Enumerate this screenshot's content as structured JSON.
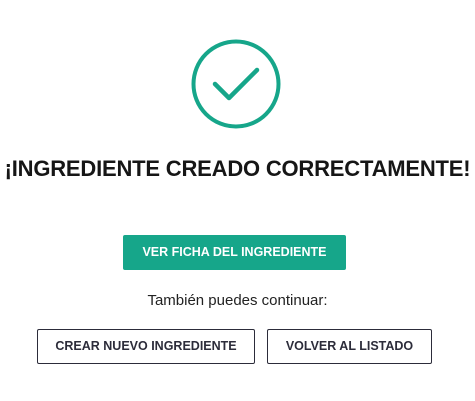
{
  "colors": {
    "accent": "#16a68a",
    "text_dark": "#161616",
    "button_outline": "#2c2c3a"
  },
  "success": {
    "icon": "check-circle-icon",
    "title": "¡INGREDIENTE CREADO CORRECTAMENTE!"
  },
  "actions": {
    "view_label": "VER FICHA DEL INGREDIENTE",
    "continue_text": "También puedes continuar:",
    "create_new_label": "CREAR NUEVO INGREDIENTE",
    "back_to_list_label": "VOLVER AL LISTADO"
  }
}
